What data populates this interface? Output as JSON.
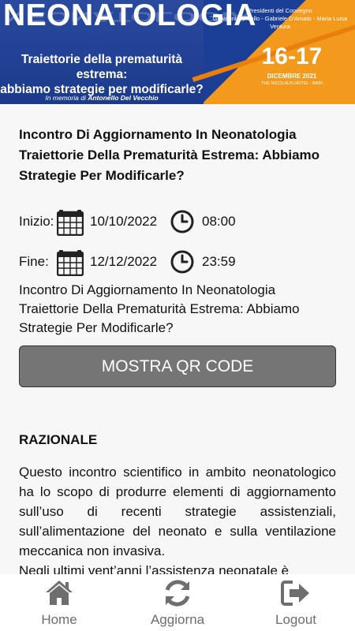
{
  "banner": {
    "title": "NEONATOLOGIA",
    "subtitle_line1": "Traiettorie della prematurità estrema:",
    "subtitle_line2": "abbiamo strategie per modificarle?",
    "memorial_prefix": "In memoria di",
    "memorial_name": "Antonello Del Vecchio",
    "presidents_label": "Presidenti del Convegno",
    "presidents_names": "Giovanni Corsello - Gabriele D'Amato - Maria Luisa Ventura",
    "days": "16-17",
    "month_year": "DICEMBRE 2021",
    "venue": "THE NICOLAUS HOTEL - BARI"
  },
  "event": {
    "title": "Incontro Di Aggiornamento In Neonatologia Traiettorie Della Prematurità Estrema: Abbiamo Strategie Per Modificarle?",
    "start_label": "Inizio:",
    "start_date": "10/10/2022",
    "start_time": "08:00",
    "end_label": "Fine:",
    "end_date": "12/12/2022",
    "end_time": "23:59",
    "description": "Incontro Di Aggiornamento In Neonatologia Traiettorie Della Prematurità Estrema: Abbiamo Strategie Per Modificarle?",
    "qr_button_label": "MOSTRA QR CODE"
  },
  "section": {
    "title": "RAZIONALE",
    "paragraph1": "Questo incontro scientifico in ambito neonatologico ha lo scopo di produrre elementi di aggiornamento sull’uso di recenti strategie assistenziali, sull’alimentazione del neonato e sulla ventilazione meccanica non invasiva.",
    "paragraph2": "Negli ultimi vent’anni l’assistenza neonatale è"
  },
  "nav": {
    "home_label": "Home",
    "refresh_label": "Aggiorna",
    "logout_label": "Logout"
  },
  "colors": {
    "banner_blue": "#1b3a8a",
    "banner_orange": "#f39a1c",
    "button_gray": "#757575",
    "nav_gray": "#6e6e6e"
  }
}
